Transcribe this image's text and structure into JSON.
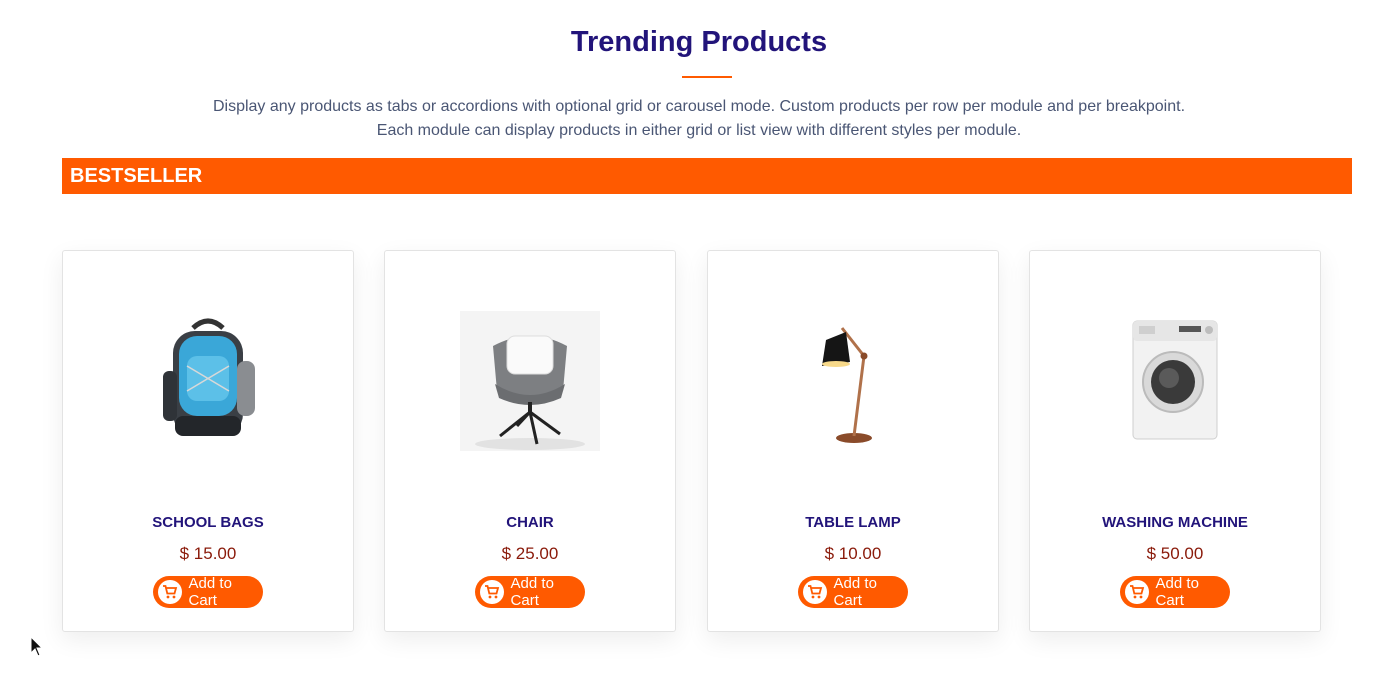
{
  "section": {
    "title": "Trending Products",
    "subtitle_line1": "Display any products as tabs or accordions with optional grid or carousel mode. Custom products per row per module and per breakpoint.",
    "subtitle_line2": "Each module can display products in either grid or list view with different styles per module."
  },
  "tab": {
    "label": "BESTSELLER"
  },
  "colors": {
    "accent": "#ff5a00",
    "title": "#22147a",
    "price": "#8a1a0a"
  },
  "products": [
    {
      "name": "SCHOOL BAGS",
      "price": "$ 15.00",
      "button": "Add to Cart",
      "icon": "backpack-image"
    },
    {
      "name": "CHAIR",
      "price": "$ 25.00",
      "button": "Add to Cart",
      "icon": "chair-image"
    },
    {
      "name": "TABLE LAMP",
      "price": "$ 10.00",
      "button": "Add to Cart",
      "icon": "lamp-image"
    },
    {
      "name": "WASHING MACHINE",
      "price": "$ 50.00",
      "button": "Add to Cart",
      "icon": "washing-machine-image"
    }
  ]
}
